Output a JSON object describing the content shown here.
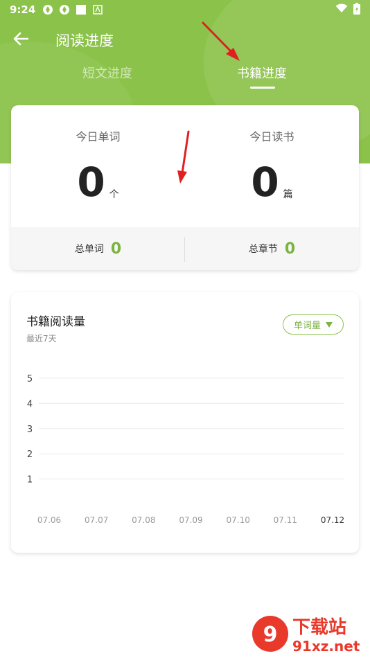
{
  "status_bar": {
    "time": "9:24"
  },
  "header": {
    "title": "阅读进度",
    "tabs": [
      {
        "label": "短文进度",
        "active": false
      },
      {
        "label": "书籍进度",
        "active": true
      }
    ]
  },
  "stats": {
    "today_words": {
      "label": "今日单词",
      "value": "0",
      "unit": "个"
    },
    "today_books": {
      "label": "今日读书",
      "value": "0",
      "unit": "篇"
    },
    "total_words": {
      "label": "总单词",
      "value": "0"
    },
    "total_chapters": {
      "label": "总章节",
      "value": "0"
    }
  },
  "chart_card": {
    "title": "书籍阅读量",
    "subtitle": "最近7天",
    "dropdown_label": "单词量"
  },
  "chart_data": {
    "type": "line",
    "title": "书籍阅读量",
    "subtitle": "最近7天",
    "categories": [
      "07.06",
      "07.07",
      "07.08",
      "07.09",
      "07.10",
      "07.11",
      "07.12"
    ],
    "y_ticks": [
      1,
      2,
      3,
      4,
      5
    ],
    "ylim": [
      0,
      5
    ],
    "series": [],
    "grid": true,
    "highlighted_category": "07.12"
  },
  "watermark": {
    "text_top": "下载站",
    "text_bottom": "91xz.net"
  },
  "colors": {
    "accent": "#8bc34a",
    "accent_dark": "#7cb342",
    "annotation_arrow": "#e02020"
  }
}
